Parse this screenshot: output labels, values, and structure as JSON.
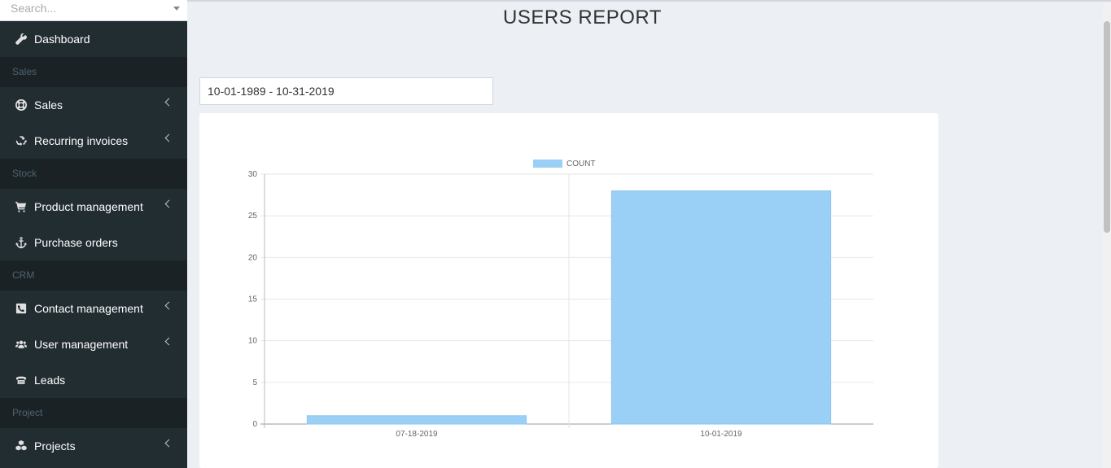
{
  "search": {
    "placeholder": "Search..."
  },
  "sidebar": {
    "items": [
      {
        "type": "item",
        "label": "Dashboard",
        "icon": "wrench-icon"
      },
      {
        "type": "header",
        "label": "Sales"
      },
      {
        "type": "item",
        "label": "Sales",
        "icon": "life-ring-icon",
        "expandable": true
      },
      {
        "type": "item",
        "label": "Recurring invoices",
        "icon": "recycle-icon",
        "expandable": true
      },
      {
        "type": "header",
        "label": "Stock"
      },
      {
        "type": "item",
        "label": "Product management",
        "icon": "cart-icon",
        "expandable": true
      },
      {
        "type": "item",
        "label": "Purchase orders",
        "icon": "anchor-icon"
      },
      {
        "type": "header",
        "label": "CRM"
      },
      {
        "type": "item",
        "label": "Contact management",
        "icon": "phone-icon",
        "expandable": true
      },
      {
        "type": "item",
        "label": "User management",
        "icon": "users-icon",
        "expandable": true
      },
      {
        "type": "item",
        "label": "Leads",
        "icon": "fax-icon"
      },
      {
        "type": "header",
        "label": "Project"
      },
      {
        "type": "item",
        "label": "Projects",
        "icon": "cubes-icon",
        "expandable": true
      }
    ]
  },
  "main": {
    "title": "USERS REPORT",
    "date_range": "10-01-1989 - 10-31-2019"
  },
  "colors": {
    "bar": "#9ad0f5",
    "sidebar": "#222d32",
    "sidebar_header": "#1a2226"
  },
  "chart_data": {
    "type": "bar",
    "categories": [
      "07-18-2019",
      "10-01-2019"
    ],
    "series": [
      {
        "name": "COUNT",
        "values": [
          1,
          28
        ]
      }
    ],
    "ylim": [
      0,
      30
    ],
    "yticks": [
      0,
      5,
      10,
      15,
      20,
      25,
      30
    ],
    "legend": "top-center",
    "grid": true
  }
}
